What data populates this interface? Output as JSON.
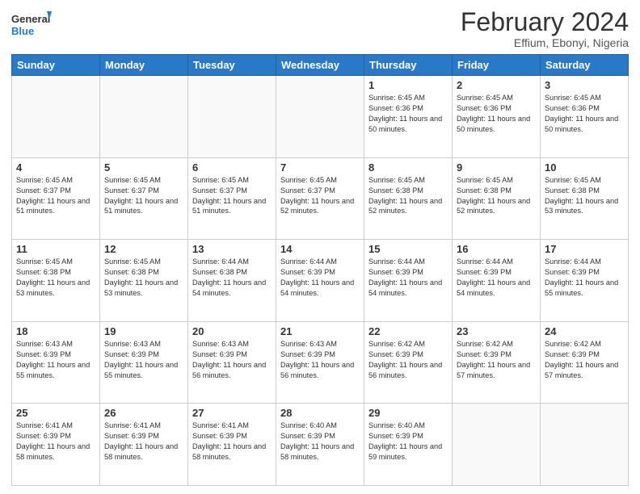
{
  "header": {
    "logo_line1": "General",
    "logo_line2": "Blue",
    "month_year": "February 2024",
    "location": "Effium, Ebonyi, Nigeria"
  },
  "days_of_week": [
    "Sunday",
    "Monday",
    "Tuesday",
    "Wednesday",
    "Thursday",
    "Friday",
    "Saturday"
  ],
  "weeks": [
    [
      {
        "day": "",
        "sunrise": "",
        "sunset": "",
        "daylight": ""
      },
      {
        "day": "",
        "sunrise": "",
        "sunset": "",
        "daylight": ""
      },
      {
        "day": "",
        "sunrise": "",
        "sunset": "",
        "daylight": ""
      },
      {
        "day": "",
        "sunrise": "",
        "sunset": "",
        "daylight": ""
      },
      {
        "day": "1",
        "sunrise": "6:45 AM",
        "sunset": "6:36 PM",
        "daylight": "11 hours and 50 minutes."
      },
      {
        "day": "2",
        "sunrise": "6:45 AM",
        "sunset": "6:36 PM",
        "daylight": "11 hours and 50 minutes."
      },
      {
        "day": "3",
        "sunrise": "6:45 AM",
        "sunset": "6:36 PM",
        "daylight": "11 hours and 50 minutes."
      }
    ],
    [
      {
        "day": "4",
        "sunrise": "6:45 AM",
        "sunset": "6:37 PM",
        "daylight": "11 hours and 51 minutes."
      },
      {
        "day": "5",
        "sunrise": "6:45 AM",
        "sunset": "6:37 PM",
        "daylight": "11 hours and 51 minutes."
      },
      {
        "day": "6",
        "sunrise": "6:45 AM",
        "sunset": "6:37 PM",
        "daylight": "11 hours and 51 minutes."
      },
      {
        "day": "7",
        "sunrise": "6:45 AM",
        "sunset": "6:37 PM",
        "daylight": "11 hours and 52 minutes."
      },
      {
        "day": "8",
        "sunrise": "6:45 AM",
        "sunset": "6:38 PM",
        "daylight": "11 hours and 52 minutes."
      },
      {
        "day": "9",
        "sunrise": "6:45 AM",
        "sunset": "6:38 PM",
        "daylight": "11 hours and 52 minutes."
      },
      {
        "day": "10",
        "sunrise": "6:45 AM",
        "sunset": "6:38 PM",
        "daylight": "11 hours and 53 minutes."
      }
    ],
    [
      {
        "day": "11",
        "sunrise": "6:45 AM",
        "sunset": "6:38 PM",
        "daylight": "11 hours and 53 minutes."
      },
      {
        "day": "12",
        "sunrise": "6:45 AM",
        "sunset": "6:38 PM",
        "daylight": "11 hours and 53 minutes."
      },
      {
        "day": "13",
        "sunrise": "6:44 AM",
        "sunset": "6:38 PM",
        "daylight": "11 hours and 54 minutes."
      },
      {
        "day": "14",
        "sunrise": "6:44 AM",
        "sunset": "6:39 PM",
        "daylight": "11 hours and 54 minutes."
      },
      {
        "day": "15",
        "sunrise": "6:44 AM",
        "sunset": "6:39 PM",
        "daylight": "11 hours and 54 minutes."
      },
      {
        "day": "16",
        "sunrise": "6:44 AM",
        "sunset": "6:39 PM",
        "daylight": "11 hours and 54 minutes."
      },
      {
        "day": "17",
        "sunrise": "6:44 AM",
        "sunset": "6:39 PM",
        "daylight": "11 hours and 55 minutes."
      }
    ],
    [
      {
        "day": "18",
        "sunrise": "6:43 AM",
        "sunset": "6:39 PM",
        "daylight": "11 hours and 55 minutes."
      },
      {
        "day": "19",
        "sunrise": "6:43 AM",
        "sunset": "6:39 PM",
        "daylight": "11 hours and 55 minutes."
      },
      {
        "day": "20",
        "sunrise": "6:43 AM",
        "sunset": "6:39 PM",
        "daylight": "11 hours and 56 minutes."
      },
      {
        "day": "21",
        "sunrise": "6:43 AM",
        "sunset": "6:39 PM",
        "daylight": "11 hours and 56 minutes."
      },
      {
        "day": "22",
        "sunrise": "6:42 AM",
        "sunset": "6:39 PM",
        "daylight": "11 hours and 56 minutes."
      },
      {
        "day": "23",
        "sunrise": "6:42 AM",
        "sunset": "6:39 PM",
        "daylight": "11 hours and 57 minutes."
      },
      {
        "day": "24",
        "sunrise": "6:42 AM",
        "sunset": "6:39 PM",
        "daylight": "11 hours and 57 minutes."
      }
    ],
    [
      {
        "day": "25",
        "sunrise": "6:41 AM",
        "sunset": "6:39 PM",
        "daylight": "11 hours and 58 minutes."
      },
      {
        "day": "26",
        "sunrise": "6:41 AM",
        "sunset": "6:39 PM",
        "daylight": "11 hours and 58 minutes."
      },
      {
        "day": "27",
        "sunrise": "6:41 AM",
        "sunset": "6:39 PM",
        "daylight": "11 hours and 58 minutes."
      },
      {
        "day": "28",
        "sunrise": "6:40 AM",
        "sunset": "6:39 PM",
        "daylight": "11 hours and 58 minutes."
      },
      {
        "day": "29",
        "sunrise": "6:40 AM",
        "sunset": "6:39 PM",
        "daylight": "11 hours and 59 minutes."
      },
      {
        "day": "",
        "sunrise": "",
        "sunset": "",
        "daylight": ""
      },
      {
        "day": "",
        "sunrise": "",
        "sunset": "",
        "daylight": ""
      }
    ]
  ]
}
